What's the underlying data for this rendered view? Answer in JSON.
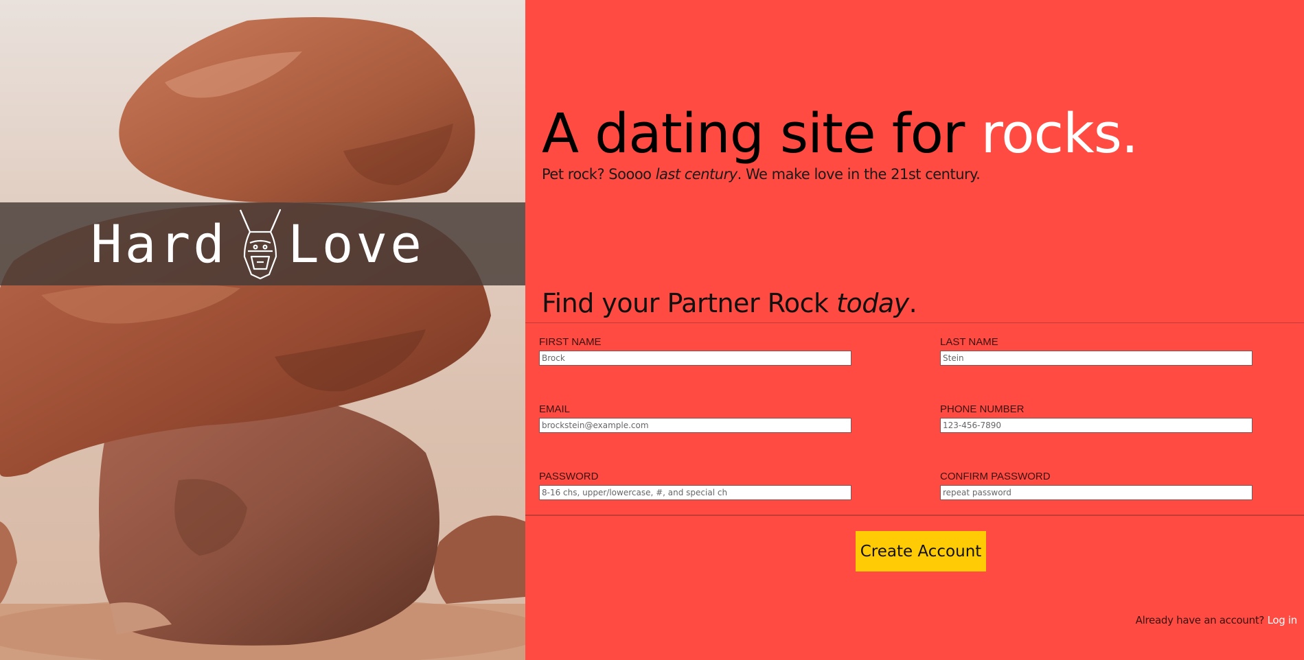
{
  "brand": {
    "logo_left": "Hard",
    "logo_right": "Love",
    "logo_mark_icon": "donkey-head-icon"
  },
  "hero": {
    "headline_dark": "A dating site for ",
    "headline_light": "rocks.",
    "sub_before": "Pet rock? Soooo ",
    "sub_em": "last century",
    "sub_after": ". We make love in the 21st century."
  },
  "form": {
    "heading_before": "Find your Partner Rock ",
    "heading_em": "today",
    "heading_after": ".",
    "fields": {
      "first_name": {
        "label": "FIRST NAME",
        "placeholder": "Brock"
      },
      "last_name": {
        "label": "LAST NAME",
        "placeholder": "Stein"
      },
      "email": {
        "label": "EMAIL",
        "placeholder": "brockstein@example.com"
      },
      "phone": {
        "label": "PHONE NUMBER",
        "placeholder": "123-456-7890"
      },
      "password": {
        "label": "PASSWORD",
        "placeholder": "8-16 chs, upper/lowercase, #, and special ch"
      },
      "confirm_password": {
        "label": "CONFIRM PASSWORD",
        "placeholder": "repeat password"
      }
    },
    "submit_label": "Create Account"
  },
  "footer": {
    "login_prompt": "Already have an account? ",
    "login_link": "Log in"
  },
  "colors": {
    "accent_red": "#ff4b42",
    "button_yellow": "#ffcb05"
  }
}
